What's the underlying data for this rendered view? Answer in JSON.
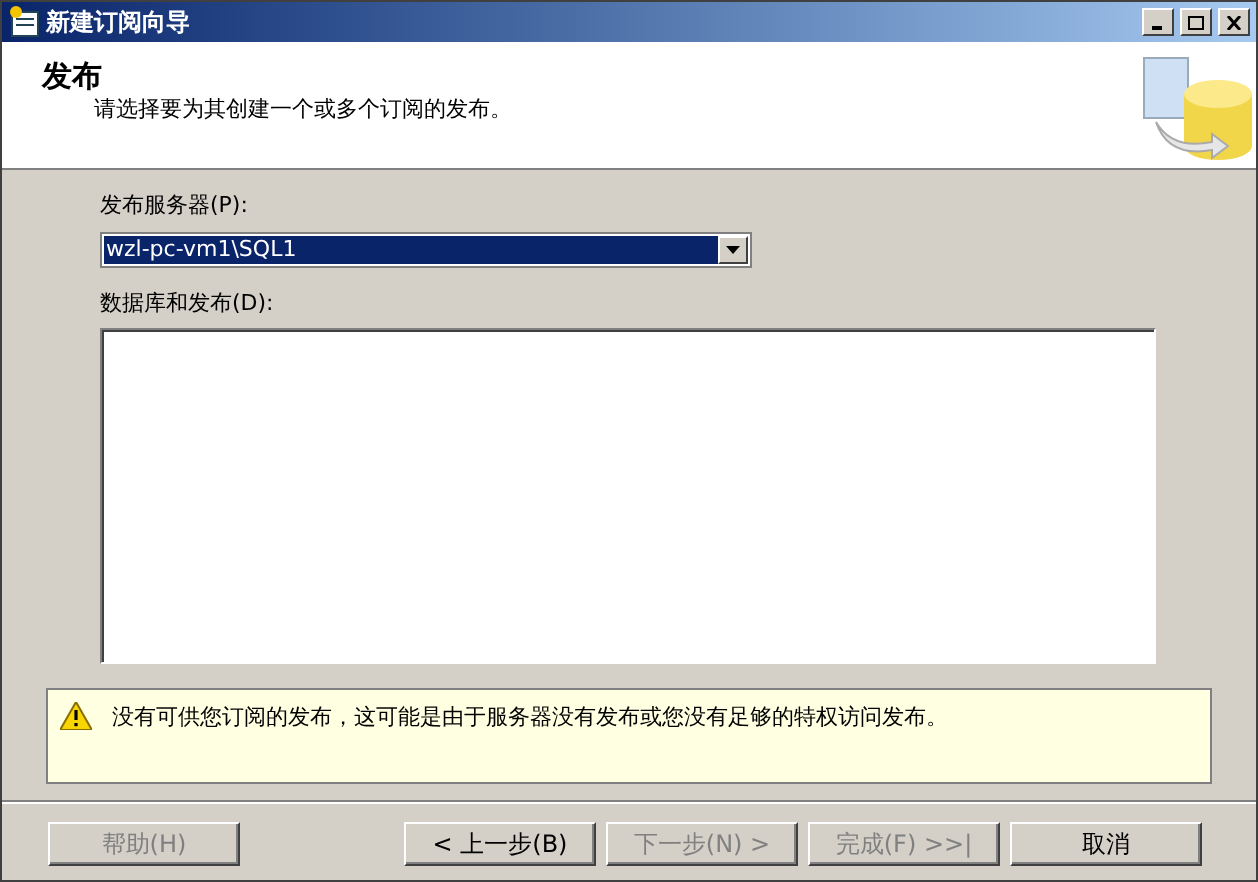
{
  "window": {
    "title": "新建订阅向导"
  },
  "header": {
    "title": "发布",
    "subtitle": "请选择要为其创建一个或多个订阅的发布。"
  },
  "publisher": {
    "label": "发布服务器(P):",
    "value": "wzl-pc-vm1\\SQL1"
  },
  "databases": {
    "label": "数据库和发布(D):"
  },
  "warning": {
    "text": "没有可供您订阅的发布，这可能是由于服务器没有发布或您没有足够的特权访问发布。"
  },
  "buttons": [
    {
      "label": "帮助(H)",
      "disabled": true,
      "kind": "help"
    },
    {
      "label": "< 上一步(B)",
      "disabled": false,
      "kind": "nav"
    },
    {
      "label": "下一步(N) >",
      "disabled": true,
      "kind": "nav"
    },
    {
      "label": "完成(F) >>|",
      "disabled": true,
      "kind": "nav"
    },
    {
      "label": "取消",
      "disabled": false,
      "kind": "cancel"
    }
  ]
}
